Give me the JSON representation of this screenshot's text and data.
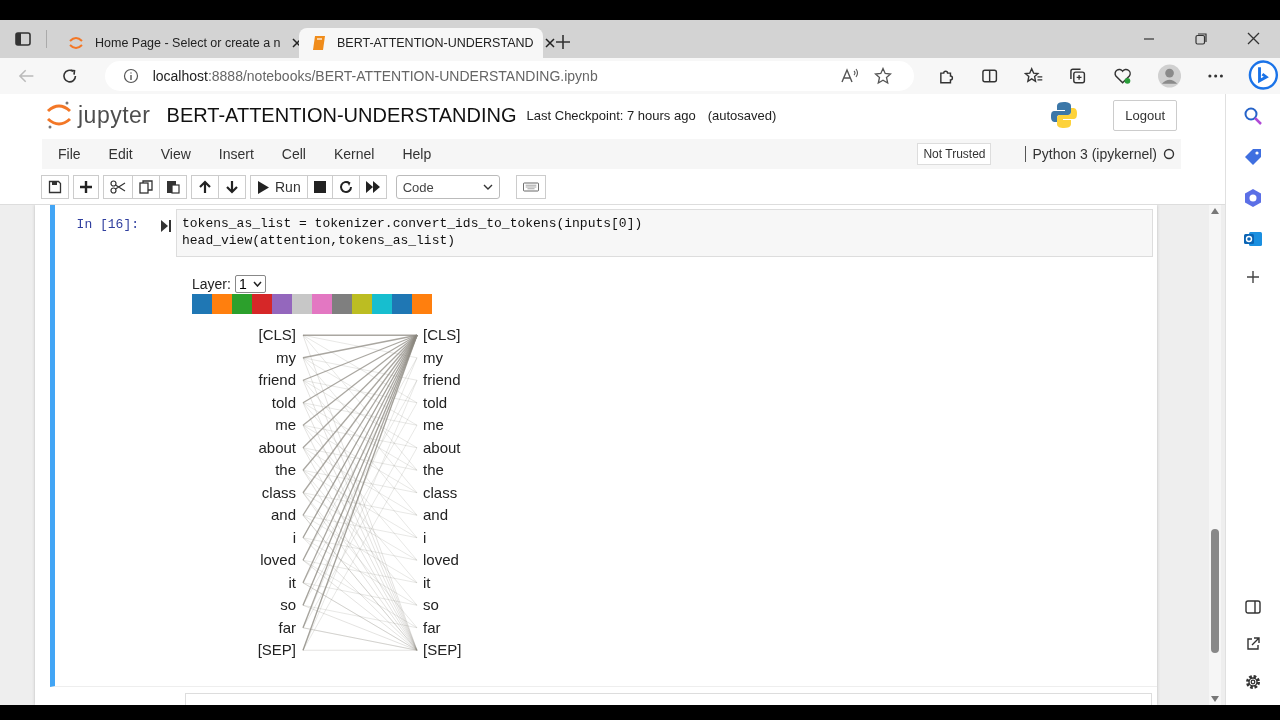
{
  "browser": {
    "tabs": [
      {
        "title": "Home Page - Select or create a n",
        "selected": false,
        "kind": "jupyter"
      },
      {
        "title": "BERT-ATTENTION-UNDERSTAND",
        "selected": true,
        "kind": "notebook"
      }
    ],
    "url_host": "localhost",
    "url_path": ":8888/notebooks/BERT-ATTENTION-UNDERSTANDING.ipynb"
  },
  "notebook": {
    "logo": "jupyter",
    "title": "BERT-ATTENTION-UNDERSTANDING",
    "checkpoint": "Last Checkpoint: 7 hours ago",
    "autosave": "(autosaved)",
    "logout": "Logout",
    "menu": [
      "File",
      "Edit",
      "View",
      "Insert",
      "Cell",
      "Kernel",
      "Help"
    ],
    "trust": "Not Trusted",
    "kernel": "Python 3 (ipykernel)",
    "run": "Run",
    "cell_type": "Code"
  },
  "cell": {
    "prompt": "In [16]:",
    "code": [
      "tokens_as_list = tokenizer.convert_ids_to_tokens(inputs[0])",
      "head_view(attention,tokens_as_list)"
    ],
    "layer_label": "Layer:",
    "layer": "1",
    "heads": [
      {
        "color": "#1f77b4"
      },
      {
        "color": "#ff7f0e"
      },
      {
        "color": "#2ca02c"
      },
      {
        "color": "#d62728"
      },
      {
        "color": "#9467bd"
      },
      {
        "color": "#c7c7c7"
      },
      {
        "color": "#e377c2"
      },
      {
        "color": "#7f7f7f"
      },
      {
        "color": "#bcbd22"
      },
      {
        "color": "#17becf"
      },
      {
        "color": "#1f77b4"
      },
      {
        "color": "#ff7f0e"
      }
    ],
    "tokens_left": [
      "[CLS]",
      "my",
      "friend",
      "told",
      "me",
      "about",
      "the",
      "class",
      "and",
      "i",
      "loved",
      "it",
      "so",
      "far",
      "[SEP]"
    ],
    "tokens_right": [
      "[CLS]",
      "my",
      "friend",
      "told",
      "me",
      "about",
      "the",
      "class",
      "and",
      "i",
      "loved",
      "it",
      "so",
      "far",
      "[SEP]"
    ]
  }
}
